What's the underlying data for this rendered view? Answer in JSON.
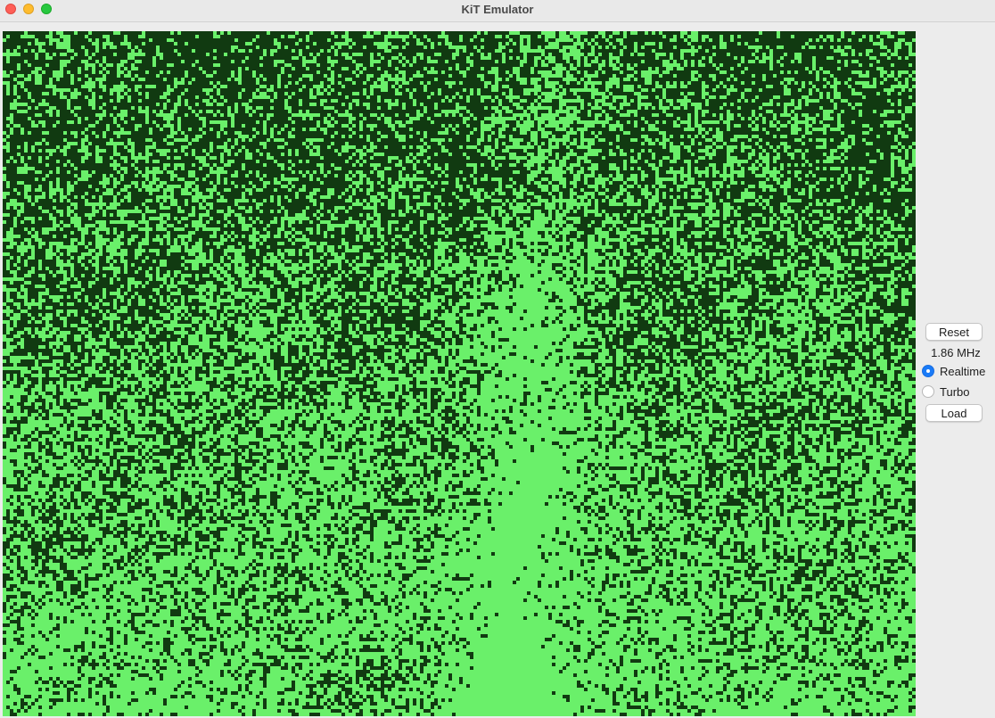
{
  "window": {
    "title": "KiT Emulator"
  },
  "screen": {
    "description_colors": {
      "dark": "#113a11",
      "mid": "#2f8a2f",
      "bright": "#6af06a"
    }
  },
  "controls": {
    "reset_label": "Reset",
    "speed_readout": "1.86 MHz",
    "mode_options": [
      {
        "label": "Realtime",
        "selected": true
      },
      {
        "label": "Turbo",
        "selected": false
      }
    ],
    "load_label": "Load"
  },
  "colors": {
    "accent": "#1a7bf7",
    "close": "#fe5f57",
    "minimize": "#febc2e",
    "maximize": "#28c840"
  }
}
